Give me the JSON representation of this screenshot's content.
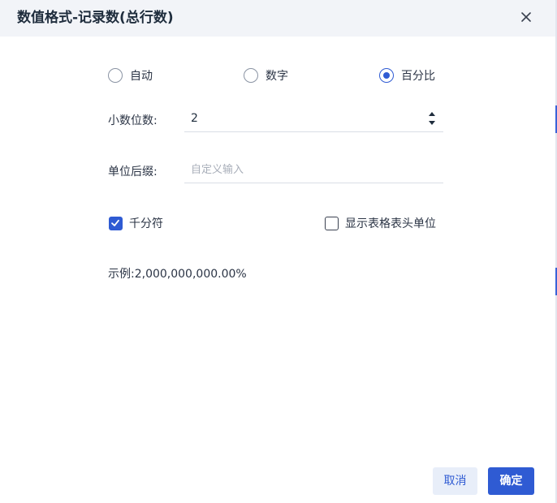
{
  "dialog": {
    "title": "数值格式-记录数(总行数)",
    "close_icon": "close-icon"
  },
  "format_type": {
    "options": [
      {
        "label": "自动",
        "checked": false
      },
      {
        "label": "数字",
        "checked": false
      },
      {
        "label": "百分比",
        "checked": true
      }
    ]
  },
  "decimal_places": {
    "label": "小数位数:",
    "value": "2"
  },
  "unit_suffix": {
    "label": "单位后缀:",
    "placeholder": "自定义输入",
    "value": ""
  },
  "thousands_separator": {
    "label": "千分符",
    "checked": true
  },
  "show_header_unit": {
    "label": "显示表格表头单位",
    "checked": false
  },
  "example": {
    "text": "示例:2,000,000,000.00%"
  },
  "footer": {
    "cancel_label": "取消",
    "ok_label": "确定"
  },
  "colors": {
    "primary": "#2f5bd3",
    "header_bg": "#f2f4f8",
    "cancel_bg": "#e8eef9"
  }
}
